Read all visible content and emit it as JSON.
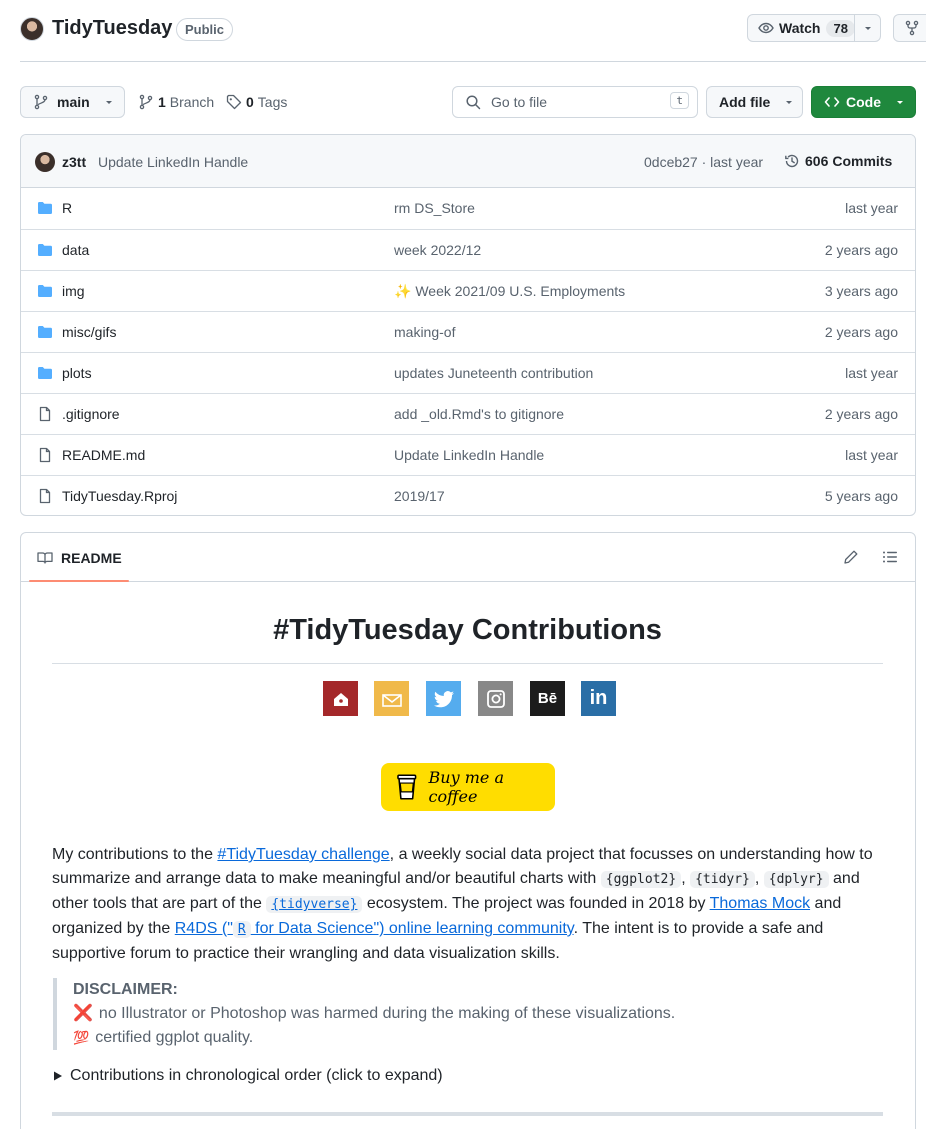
{
  "header": {
    "repo_name": "TidyTuesday",
    "visibility": "Public",
    "watch_label": "Watch",
    "watch_count": "78"
  },
  "toolbar": {
    "branch": "main",
    "branch_count": "1",
    "branch_label": "Branch",
    "tag_count": "0",
    "tag_label": "Tags",
    "search_placeholder": "Go to file",
    "search_shortcut": "t",
    "add_file_label": "Add file",
    "code_label": "Code"
  },
  "latest_commit": {
    "author": "z3tt",
    "message": "Update LinkedIn Handle",
    "hash_time": "0dceb27 · last year",
    "commits_count": "606",
    "commits_label": "Commits"
  },
  "files": [
    {
      "type": "folder",
      "name": "R",
      "message": "rm DS_Store",
      "date": "last year"
    },
    {
      "type": "folder",
      "name": "data",
      "message": "week 2022/12",
      "date": "2 years ago"
    },
    {
      "type": "folder",
      "name": "img",
      "message": "✨ Week 2021/09 U.S. Employments",
      "date": "3 years ago"
    },
    {
      "type": "folder",
      "name": "misc/gifs",
      "message": "making-of",
      "date": "2 years ago"
    },
    {
      "type": "folder",
      "name": "plots",
      "message": "updates Juneteenth contribution",
      "date": "last year"
    },
    {
      "type": "file",
      "name": ".gitignore",
      "message": "add _old.Rmd's to gitignore",
      "date": "2 years ago"
    },
    {
      "type": "file",
      "name": "README.md",
      "message": "Update LinkedIn Handle",
      "date": "last year"
    },
    {
      "type": "file",
      "name": "TidyTuesday.Rproj",
      "message": "2019/17",
      "date": "5 years ago"
    }
  ],
  "readme": {
    "tab_label": "README",
    "title": "#TidyTuesday Contributions",
    "socials": [
      {
        "name": "website",
        "color": "#a4282a"
      },
      {
        "name": "email",
        "color": "#f0b94a"
      },
      {
        "name": "twitter",
        "color": "#55acee"
      },
      {
        "name": "instagram",
        "color": "#888888"
      },
      {
        "name": "behance",
        "color": "#1c1c1c"
      },
      {
        "name": "linkedin",
        "color": "#2a6ea6"
      }
    ],
    "coffee_label": "Buy me a coffee",
    "para": {
      "t1": "My contributions to the ",
      "link1": "#TidyTuesday challenge",
      "t2": ", a weekly social data project that focusses on understanding how to summarize and arrange data to make meaningful and/or beautiful charts with ",
      "code1": "{ggplot2}",
      "sep1": ", ",
      "code2": "{tidyr}",
      "sep2": ", ",
      "code3": "{dplyr}",
      "t3": " and other tools that are part of the ",
      "code4": "{tidyverse}",
      "t4": " ecosystem. The project was founded in 2018 by ",
      "link2": "Thomas Mock",
      "t5": " and organized by the ",
      "link3a": "R4DS (\"",
      "code5": "R",
      "link3b": " for Data Science\") online learning community",
      "t6": ". The intent is to provide a safe and supportive forum to practice their wrangling and data visualization skills."
    },
    "disclaimer_title": "DISCLAIMER:",
    "disclaimer_line1_emoji": "❌",
    "disclaimer_line1": "no Illustrator or Photoshop was harmed during the making of these visualizations.",
    "disclaimer_line2_emoji": "💯",
    "disclaimer_line2": "certified ggplot quality.",
    "details_label": "Contributions in chronological order (click to expand)"
  },
  "colors": {
    "accent_green": "#1f883d",
    "link_blue": "#0969da",
    "folder_blue": "#54aeff",
    "tab_underline": "#fd8c73",
    "coffee_yellow": "#ffdd00"
  }
}
